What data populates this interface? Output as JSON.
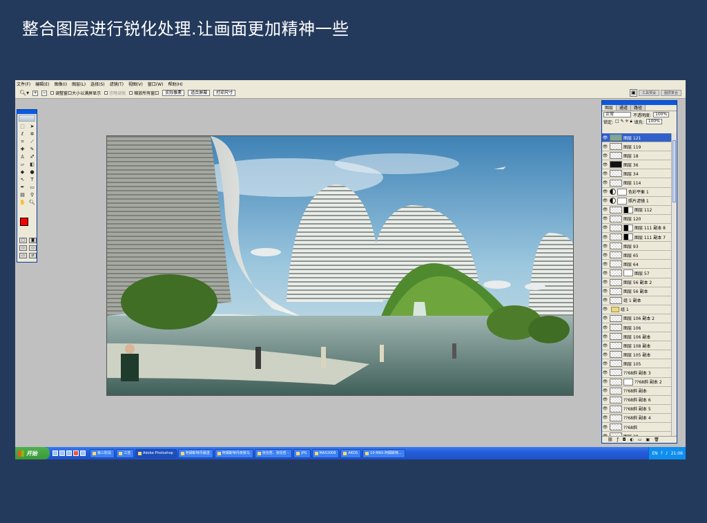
{
  "slide_title": "整合图层进行锐化处理.让画面更加精神一些",
  "menu": [
    "文件(F)",
    "编辑(E)",
    "图像(I)",
    "图层(L)",
    "选择(S)",
    "滤镜(T)",
    "视图(V)",
    "窗口(W)",
    "帮助(H)"
  ],
  "options": {
    "resize_window": "调整窗口大小以满屏显示",
    "ignore_palettes": "忽略调板",
    "zoom_all": "缩放所有窗口",
    "actual_pixels": "实际像素",
    "fit_screen": "适合屏幕",
    "print_size": "打印尺寸",
    "tab_tool_presets": "工具预设",
    "tab_brushes": "图层复合"
  },
  "layers_panel": {
    "tab_layers": "图层",
    "tab_channels": "通道",
    "tab_paths": "路径",
    "blend_mode": "正常",
    "opacity_label": "不透明度:",
    "opacity_value": "100%",
    "lock_label": "锁定:",
    "fill_label": "填充:",
    "fill_value": "100%",
    "layers": [
      {
        "name": "图层 121",
        "type": "pic",
        "selected": true
      },
      {
        "name": "图层 119",
        "type": "empty"
      },
      {
        "name": "图层 18",
        "type": "empty"
      },
      {
        "name": "图层 36",
        "type": "dark"
      },
      {
        "name": "图层 34",
        "type": "empty"
      },
      {
        "name": "图层 114",
        "type": "empty"
      },
      {
        "name": "色彩平衡 1",
        "type": "adjust"
      },
      {
        "name": "照片滤镜 1",
        "type": "adjust"
      },
      {
        "name": "图层 112",
        "type": "mask"
      },
      {
        "name": "图层 120",
        "type": "empty"
      },
      {
        "name": "图层 111 副本 8",
        "type": "mask"
      },
      {
        "name": "图层 111 副本 7",
        "type": "mask"
      },
      {
        "name": "图层 93",
        "type": "empty"
      },
      {
        "name": "图层 65",
        "type": "empty"
      },
      {
        "name": "图层 64",
        "type": "empty"
      },
      {
        "name": "图层 57",
        "type": "whitemask"
      },
      {
        "name": "图层 56 副本 2",
        "type": "empty"
      },
      {
        "name": "图层 56 副本",
        "type": "empty"
      },
      {
        "name": "组 1 副本",
        "type": "empty"
      },
      {
        "name": "组 1",
        "type": "folder"
      },
      {
        "name": "图层 106 副本 2",
        "type": "empty"
      },
      {
        "name": "图层 106",
        "type": "empty"
      },
      {
        "name": "图层 106 副本",
        "type": "empty"
      },
      {
        "name": "图层 108 副本",
        "type": "empty"
      },
      {
        "name": "图层 105 副本",
        "type": "empty"
      },
      {
        "name": "图层 105",
        "type": "empty"
      },
      {
        "name": "??68斜 副本 3",
        "type": "empty"
      },
      {
        "name": "??68斜 副本 2",
        "type": "whitemask"
      },
      {
        "name": "??68斜 副本",
        "type": "empty"
      },
      {
        "name": "??68斜 副本 6",
        "type": "empty"
      },
      {
        "name": "??68斜 副本 5",
        "type": "empty"
      },
      {
        "name": "??68斜 副本 4",
        "type": "empty"
      },
      {
        "name": "??68斜",
        "type": "empty"
      },
      {
        "name": "图层 28",
        "type": "empty"
      }
    ]
  },
  "taskbar": {
    "start": "开始",
    "tasks": [
      "第三阶段",
      "江浩",
      "Adobe Photoshop",
      "阿姆斯特丹晨透",
      "阿姆斯特丹夜景鸟",
      "张信哲、张信哲 -",
      "JPG",
      "MAX2008",
      "AKDS",
      "10-MAS-阿姆斯特..."
    ],
    "active_task": 2,
    "ime": "EN",
    "clock": "21:06"
  }
}
